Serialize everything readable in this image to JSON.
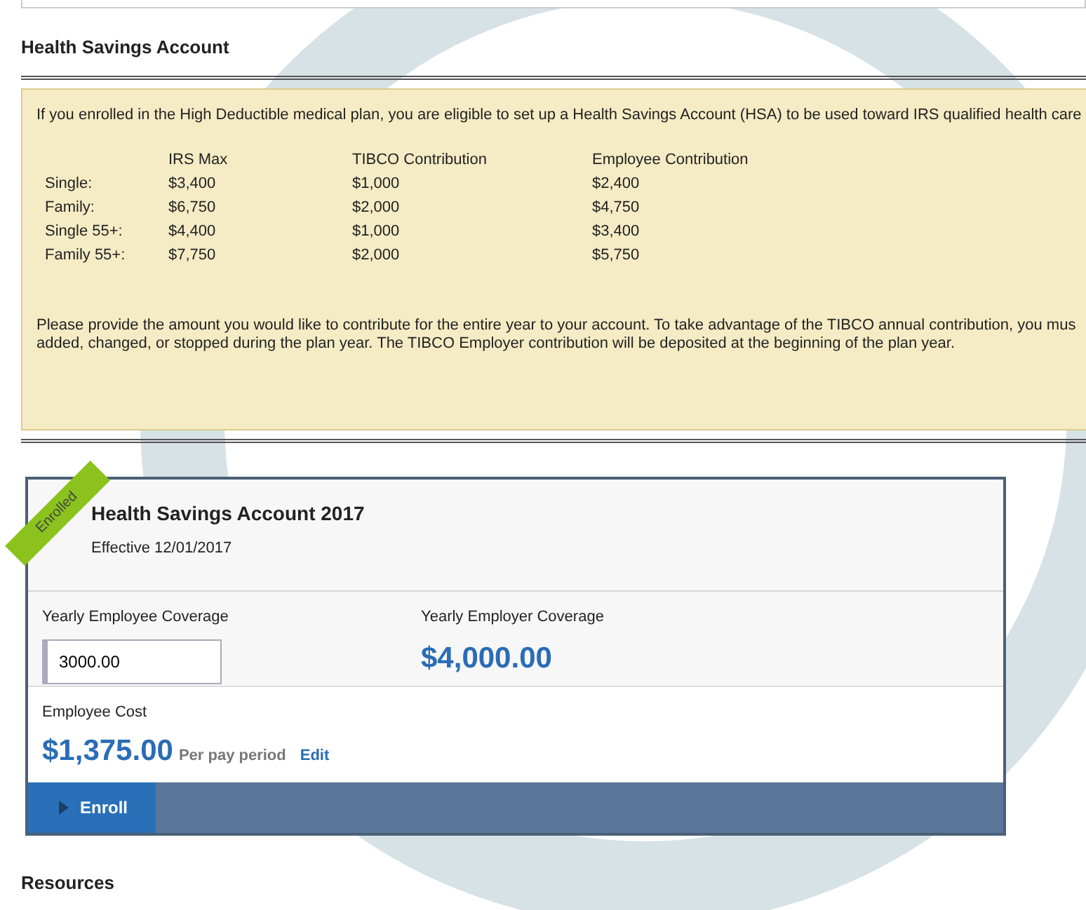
{
  "page_title": "Health Savings Account",
  "info_panel": {
    "intro": "If you enrolled in the High Deductible medical plan, you are eligible to set up a Health Savings Account (HSA) to be used toward IRS qualified health care",
    "table": {
      "columns": [
        "IRS Max",
        "TIBCO Contribution",
        "Employee Contribution"
      ],
      "rows": [
        {
          "label": "Single:",
          "cells": [
            "$3,400",
            "$1,000",
            "$2,400"
          ]
        },
        {
          "label": "Family:",
          "cells": [
            "$6,750",
            "$2,000",
            "$4,750"
          ]
        },
        {
          "label": "Single 55+:",
          "cells": [
            "$4,400",
            "$1,000",
            "$3,400"
          ]
        },
        {
          "label": "Family 55+:",
          "cells": [
            "$7,750",
            "$2,000",
            "$5,750"
          ]
        }
      ]
    },
    "note_lines": [
      "Please provide the amount you would like to contribute for the entire year to your account. To take advantage of the TIBCO annual contribution, you mus",
      "added, changed, or stopped during the plan year. The TIBCO Employer contribution will be deposited at the beginning of the plan year."
    ]
  },
  "plan_card": {
    "ribbon": "Enrolled",
    "title": "Health Savings Account 2017",
    "effective": "Effective 12/01/2017",
    "employee_coverage": {
      "label": "Yearly Employee Coverage",
      "value": "3000.00"
    },
    "employer_coverage": {
      "label": "Yearly Employer Coverage",
      "amount": "$4,000.00"
    },
    "cost": {
      "label": "Employee Cost",
      "amount": "$1,375.00",
      "period": "Per pay period",
      "edit": "Edit"
    },
    "enroll_button": "Enroll"
  },
  "resources_title": "Resources"
}
